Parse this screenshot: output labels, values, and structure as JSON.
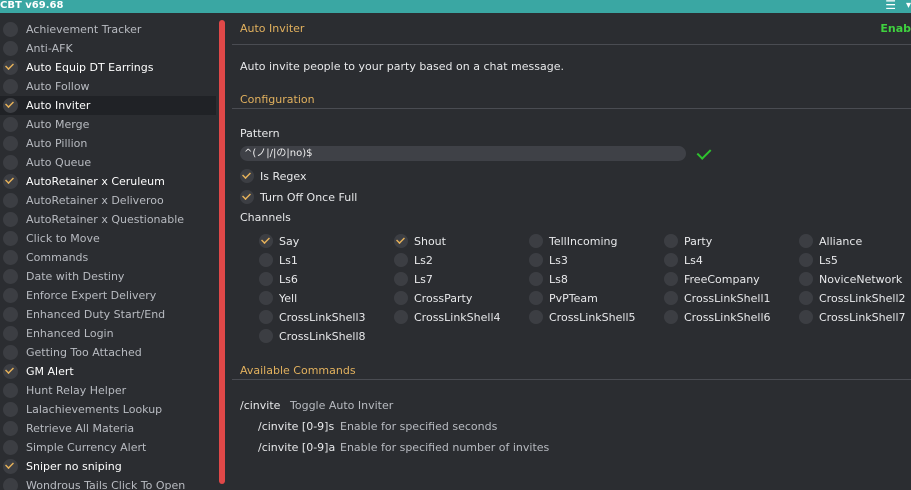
{
  "window": {
    "title": "CBT v69.68",
    "menu_icon": "hamburger-icon"
  },
  "sidebar": {
    "items": [
      {
        "label": "Achievement Tracker",
        "checked": false
      },
      {
        "label": "Anti-AFK",
        "checked": false
      },
      {
        "label": "Auto Equip DT Earrings",
        "checked": true
      },
      {
        "label": "Auto Follow",
        "checked": false
      },
      {
        "label": "Auto Inviter",
        "checked": true,
        "selected": true
      },
      {
        "label": "Auto Merge",
        "checked": false
      },
      {
        "label": "Auto Pillion",
        "checked": false
      },
      {
        "label": "Auto Queue",
        "checked": false
      },
      {
        "label": "AutoRetainer x Ceruleum",
        "checked": true
      },
      {
        "label": "AutoRetainer x Deliveroo",
        "checked": false
      },
      {
        "label": "AutoRetainer x Questionable",
        "checked": false
      },
      {
        "label": "Click to Move",
        "checked": false
      },
      {
        "label": "Commands",
        "checked": false
      },
      {
        "label": "Date with Destiny",
        "checked": false
      },
      {
        "label": "Enforce Expert Delivery",
        "checked": false
      },
      {
        "label": "Enhanced Duty Start/End",
        "checked": false
      },
      {
        "label": "Enhanced Login",
        "checked": false
      },
      {
        "label": "Getting Too Attached",
        "checked": false
      },
      {
        "label": "GM Alert",
        "checked": true
      },
      {
        "label": "Hunt Relay Helper",
        "checked": false
      },
      {
        "label": "Lalachievements Lookup",
        "checked": false
      },
      {
        "label": "Retrieve All Materia",
        "checked": false
      },
      {
        "label": "Simple Currency Alert",
        "checked": false
      },
      {
        "label": "Sniper no sniping",
        "checked": true
      },
      {
        "label": "Wondrous Tails Click To Open",
        "checked": false
      }
    ]
  },
  "main": {
    "header": "Auto Inviter",
    "enabled_label": "Enab",
    "description": "Auto invite people to your party based on a chat message.",
    "configuration_title": "Configuration",
    "pattern_label": "Pattern",
    "pattern_value": "^(ノ|/|の|no)$",
    "is_regex_label": "Is Regex",
    "is_regex": true,
    "turn_off_label": "Turn Off Once Full",
    "turn_off": true,
    "channels_label": "Channels",
    "channels": [
      {
        "label": "Say",
        "checked": true
      },
      {
        "label": "Shout",
        "checked": true
      },
      {
        "label": "TellIncoming",
        "checked": false
      },
      {
        "label": "Party",
        "checked": false
      },
      {
        "label": "Alliance",
        "checked": false
      },
      {
        "label": "Ls1",
        "checked": false
      },
      {
        "label": "Ls2",
        "checked": false
      },
      {
        "label": "Ls3",
        "checked": false
      },
      {
        "label": "Ls4",
        "checked": false
      },
      {
        "label": "Ls5",
        "checked": false
      },
      {
        "label": "Ls6",
        "checked": false
      },
      {
        "label": "Ls7",
        "checked": false
      },
      {
        "label": "Ls8",
        "checked": false
      },
      {
        "label": "FreeCompany",
        "checked": false
      },
      {
        "label": "NoviceNetwork",
        "checked": false
      },
      {
        "label": "Yell",
        "checked": false
      },
      {
        "label": "CrossParty",
        "checked": false
      },
      {
        "label": "PvPTeam",
        "checked": false
      },
      {
        "label": "CrossLinkShell1",
        "checked": false
      },
      {
        "label": "CrossLinkShell2",
        "checked": false
      },
      {
        "label": "CrossLinkShell3",
        "checked": false
      },
      {
        "label": "CrossLinkShell4",
        "checked": false
      },
      {
        "label": "CrossLinkShell5",
        "checked": false
      },
      {
        "label": "CrossLinkShell6",
        "checked": false
      },
      {
        "label": "CrossLinkShell7",
        "checked": false
      },
      {
        "label": "CrossLinkShell8",
        "checked": false
      }
    ],
    "commands_title": "Available Commands",
    "commands": [
      {
        "cmd": "/cinvite",
        "desc": "Toggle Auto Inviter"
      },
      {
        "cmd": "/cinvite [0-9]s",
        "desc": "Enable for specified seconds"
      },
      {
        "cmd": "/cinvite [0-9]a",
        "desc": "Enable for specified number of invites"
      }
    ]
  },
  "colors": {
    "titlebar": "#3aa7a3",
    "accent_section": "#e2b15e",
    "check": "#e8b35a",
    "enabled": "#3fd13f",
    "scroll_divider": "#e04848"
  }
}
